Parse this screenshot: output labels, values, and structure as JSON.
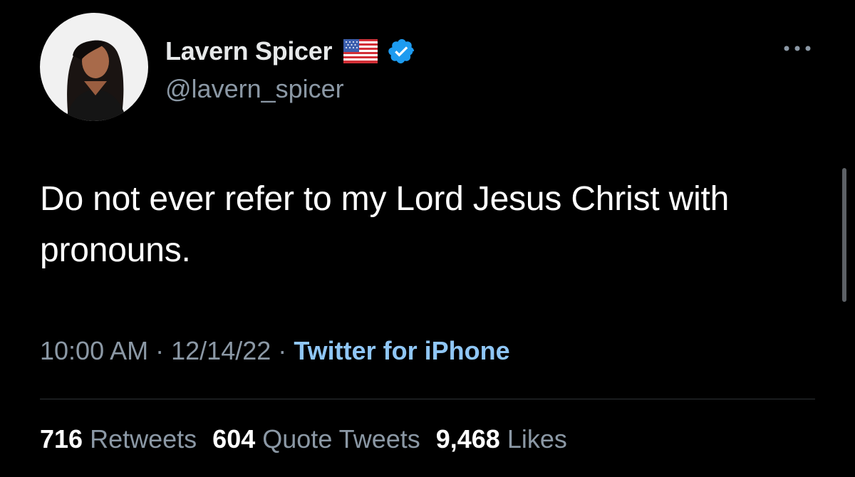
{
  "user": {
    "display_name": "Lavern Spicer",
    "handle": "@lavern_spicer",
    "flag_icon": "us-flag-icon",
    "verified_icon": "verified-badge-icon",
    "verified_color": "#1d9bf0"
  },
  "tweet": {
    "text": "Do not ever refer to my Lord Jesus Christ with pronouns."
  },
  "meta": {
    "time": "10:00 AM",
    "separator": "·",
    "date": "12/14/22",
    "source": "Twitter for iPhone"
  },
  "stats": {
    "retweets_count": "716",
    "retweets_label": "Retweets",
    "quotes_count": "604",
    "quotes_label": "Quote Tweets",
    "likes_count": "9,468",
    "likes_label": "Likes"
  },
  "colors": {
    "background": "#000000",
    "text_primary": "#e7e9ea",
    "text_secondary": "#8b98a5",
    "link": "#8fc6f5",
    "divider": "#2f3336"
  }
}
